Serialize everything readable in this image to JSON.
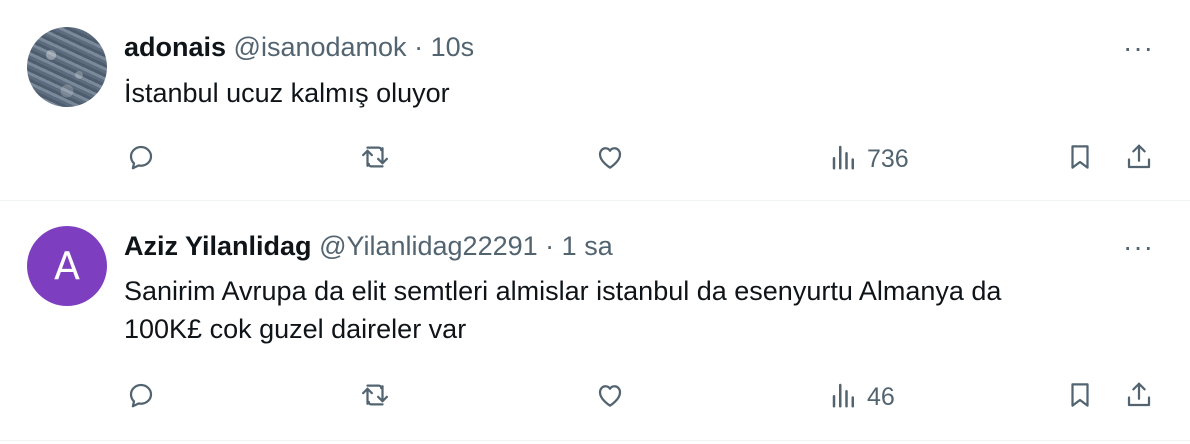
{
  "tweets": [
    {
      "name": "adonais",
      "handle": "@isanodamok",
      "separator": "·",
      "time": "10s",
      "text_lines": [
        "İstanbul ucuz kalmış oluyor"
      ],
      "avatar": "photo",
      "views": "736"
    },
    {
      "name": "Aziz Yilanlidag",
      "handle": "@Yilanlidag22291",
      "separator": "·",
      "time": "1 sa",
      "text_lines": [
        "Sanirim Avrupa da elit semtleri almislar istanbul da esenyurtu Almanya da",
        "100K£ cok guzel daireler var"
      ],
      "avatar_letter": "A",
      "avatar_color": "#7d3fbf",
      "views": "46"
    }
  ],
  "more_label": "···",
  "icons": [
    "reply-icon",
    "retweet-icon",
    "like-icon",
    "views-icon",
    "bookmark-icon",
    "share-icon"
  ],
  "colors": {
    "text": "#0f1419",
    "muted": "#536471",
    "divider": "#eff3f4"
  }
}
